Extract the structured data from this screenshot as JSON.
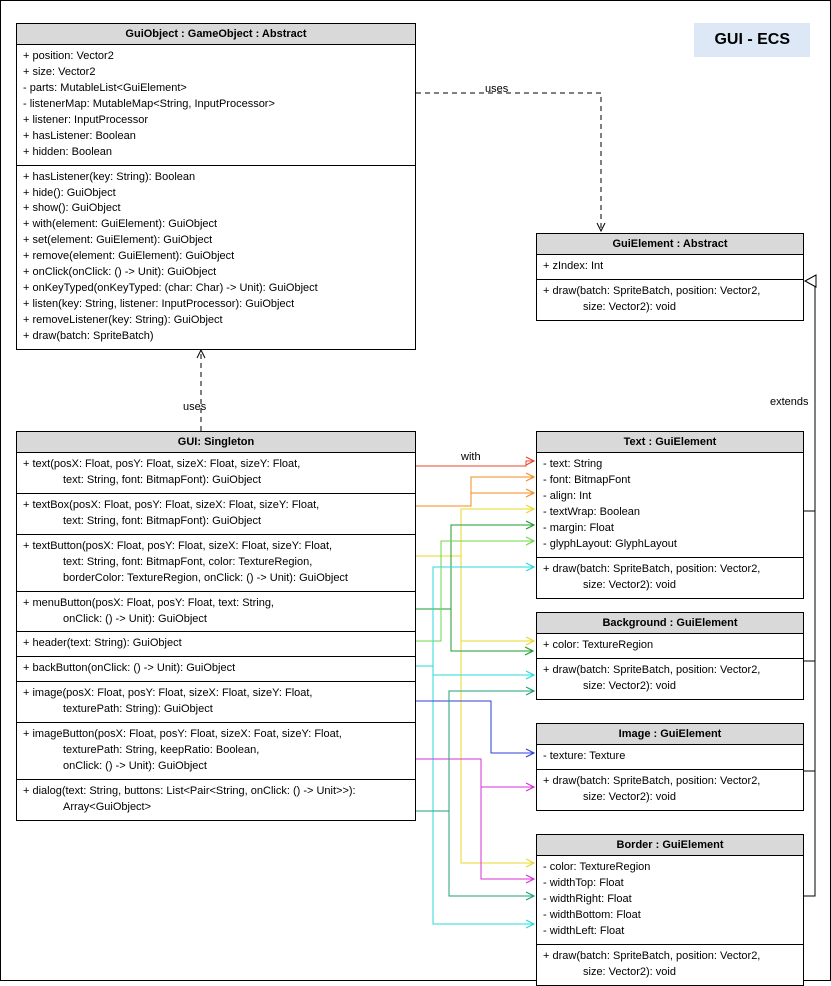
{
  "title": "GUI - ECS",
  "relations": {
    "uses1": "uses",
    "uses2": "uses",
    "with": "with",
    "extends": "extends"
  },
  "guiobject": {
    "header": "GuiObject : GameObject : Abstract",
    "attrs": [
      "+ position: Vector2",
      "+ size: Vector2",
      "- parts: MutableList<GuiElement>",
      "- listenerMap: MutableMap<String, InputProcessor>",
      "+ listener: InputProcessor",
      "+ hasListener: Boolean",
      "+ hidden: Boolean"
    ],
    "methods": [
      "+ hasListener(key: String): Boolean",
      "+ hide(): GuiObject",
      "+ show(): GuiObject",
      "+ with(element: GuiElement): GuiObject",
      "+ set(element: GuiElement): GuiObject",
      "+ remove(element: GuiElement): GuiObject",
      "+ onClick(onClick: () -> Unit): GuiObject",
      "+ onKeyTyped(onKeyTyped: (char: Char) -> Unit): GuiObject",
      "+ listen(key: String, listener: InputProcessor): GuiObject",
      "+ removeListener(key: String): GuiObject",
      "+ draw(batch: SpriteBatch)"
    ]
  },
  "guielement": {
    "header": "GuiElement : Abstract",
    "attrs": [
      "+ zIndex: Int"
    ],
    "methods": [
      "+ draw(batch: SpriteBatch, position: Vector2,",
      "size: Vector2): void"
    ]
  },
  "gui": {
    "header": "GUI: Singleton",
    "m0": [
      "+ text(posX: Float, posY: Float, sizeX: Float, sizeY: Float,",
      "text: String, font: BitmapFont): GuiObject"
    ],
    "m1": [
      "+ textBox(posX: Float, posY: Float, sizeX: Float, sizeY: Float,",
      "text: String, font: BitmapFont): GuiObject"
    ],
    "m2": [
      "+ textButton(posX: Float, posY: Float, sizeX: Float, sizeY: Float,",
      "text: String, font: BitmapFont, color: TextureRegion,",
      "borderColor: TextureRegion, onClick: () -> Unit): GuiObject"
    ],
    "m3": [
      "+ menuButton(posX: Float, posY: Float, text: String,",
      "onClick: () -> Unit): GuiObject"
    ],
    "m4": [
      "+ header(text: String): GuiObject"
    ],
    "m5": [
      "+ backButton(onClick: () -> Unit): GuiObject"
    ],
    "m6": [
      "+ image(posX: Float, posY: Float, sizeX: Float, sizeY: Float,",
      "texturePath: String): GuiObject"
    ],
    "m7": [
      "+ imageButton(posX: Float, posY: Float, sizeX: Foat, sizeY: Float,",
      "texturePath: String, keepRatio: Boolean,",
      "onClick: () -> Unit): GuiObject"
    ],
    "m8": [
      "+ dialog(text: String, buttons: List<Pair<String, onClick: () -> Unit>>):",
      "Array<GuiObject>"
    ]
  },
  "text": {
    "header": "Text : GuiElement",
    "attrs": [
      "- text: String",
      "- font: BitmapFont",
      "- align: Int",
      "- textWrap: Boolean",
      "- margin: Float",
      "- glyphLayout: GlyphLayout"
    ],
    "methods": [
      "+ draw(batch: SpriteBatch, position: Vector2,",
      "size: Vector2): void"
    ]
  },
  "background": {
    "header": "Background : GuiElement",
    "attrs": [
      "+ color: TextureRegion"
    ],
    "methods": [
      "+ draw(batch: SpriteBatch, position: Vector2,",
      "size: Vector2): void"
    ]
  },
  "image": {
    "header": "Image : GuiElement",
    "attrs": [
      "- texture: Texture"
    ],
    "methods": [
      "+ draw(batch: SpriteBatch, position: Vector2,",
      "size: Vector2): void"
    ]
  },
  "border": {
    "header": "Border : GuiElement",
    "attrs": [
      "- color: TextureRegion",
      "- widthTop: Float",
      "- widthRight: Float",
      "- widthBottom: Float",
      "- widthLeft: Float"
    ],
    "methods": [
      "+ draw(batch: SpriteBatch, position: Vector2,",
      "size: Vector2): void"
    ]
  }
}
